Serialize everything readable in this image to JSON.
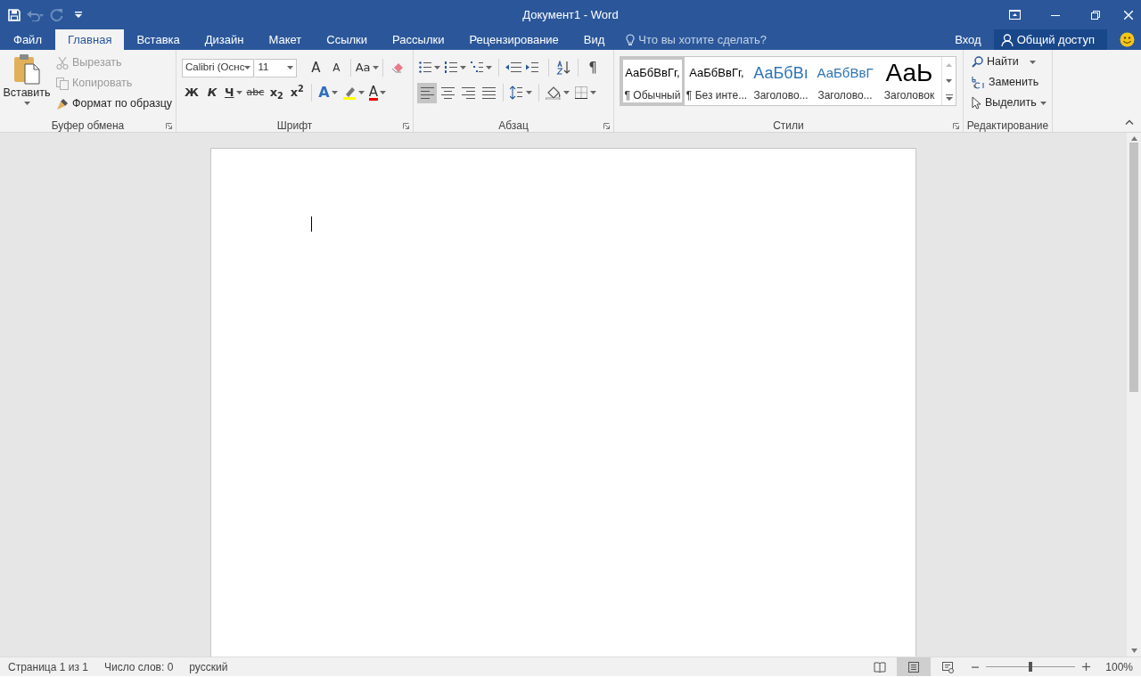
{
  "window": {
    "title": "Документ1 - Word"
  },
  "quick_access": [
    {
      "kind": "save",
      "disabled": false
    },
    {
      "kind": "undo",
      "disabled": true
    },
    {
      "kind": "redo",
      "disabled": true
    },
    {
      "kind": "customize",
      "disabled": false
    }
  ],
  "tabs": [
    {
      "label": "Файл",
      "selected": false
    },
    {
      "label": "Главная",
      "selected": true
    },
    {
      "label": "Вставка",
      "selected": false
    },
    {
      "label": "Дизайн",
      "selected": false
    },
    {
      "label": "Макет",
      "selected": false
    },
    {
      "label": "Ссылки",
      "selected": false
    },
    {
      "label": "Рассылки",
      "selected": false
    },
    {
      "label": "Рецензирование",
      "selected": false
    },
    {
      "label": "Вид",
      "selected": false
    }
  ],
  "tell_me": {
    "placeholder": "Что вы хотите сделать?"
  },
  "account": {
    "sign_in": "Вход",
    "share": "Общий доступ"
  },
  "clipboard": {
    "paste": "Вставить",
    "items": [
      {
        "kind": "cut",
        "label": "Вырезать",
        "disabled": true
      },
      {
        "kind": "copy",
        "label": "Копировать",
        "disabled": true
      },
      {
        "kind": "painter",
        "label": "Формат по образцу",
        "disabled": false
      }
    ],
    "label": "Буфер обмена"
  },
  "font": {
    "name": "Calibri (Оснс",
    "size": "11",
    "grow": "A",
    "shrink": "A",
    "case": "Aa",
    "bold": "Ж",
    "italic": "К",
    "underline": "Ч",
    "strike": "abc",
    "subscript": "x$_{2}$",
    "superscript": "x$^{2}$",
    "effects": "A",
    "font_color_letter": "A",
    "label": "Шрифт"
  },
  "paragraph": {
    "pilcrow": "¶",
    "alignment": [
      {
        "kind": "left",
        "selected": true
      },
      {
        "kind": "center",
        "selected": false
      },
      {
        "kind": "right",
        "selected": false
      },
      {
        "kind": "justify",
        "selected": false
      }
    ],
    "label": "Абзац"
  },
  "styles": {
    "items": [
      {
        "kind": "normal",
        "preview": "АаБбВвГг,",
        "name": "¶ Обычный",
        "selected": true
      },
      {
        "kind": "normal",
        "preview": "АаБбВвГг,",
        "name": "¶ Без инте...",
        "selected": false
      },
      {
        "kind": "heading1",
        "preview": "АаБбВı",
        "name": "Заголово...",
        "selected": false
      },
      {
        "kind": "heading2",
        "preview": "АаБбВвГ",
        "name": "Заголово...",
        "selected": false
      },
      {
        "kind": "title",
        "preview": "АаЬ",
        "name": "Заголовок",
        "selected": false
      }
    ],
    "label": "Стили"
  },
  "editing": {
    "find": "Найти",
    "replace": "Заменить",
    "select": "Выделить",
    "label": "Редактирование"
  },
  "status_bar": {
    "page": "Страница 1 из 1",
    "words": "Число слов: 0",
    "language": "русский",
    "views": [
      {
        "kind": "read",
        "selected": false
      },
      {
        "kind": "print",
        "selected": true
      },
      {
        "kind": "web",
        "selected": false
      }
    ],
    "zoom": {
      "level": 0.5,
      "reading": "100%"
    }
  }
}
